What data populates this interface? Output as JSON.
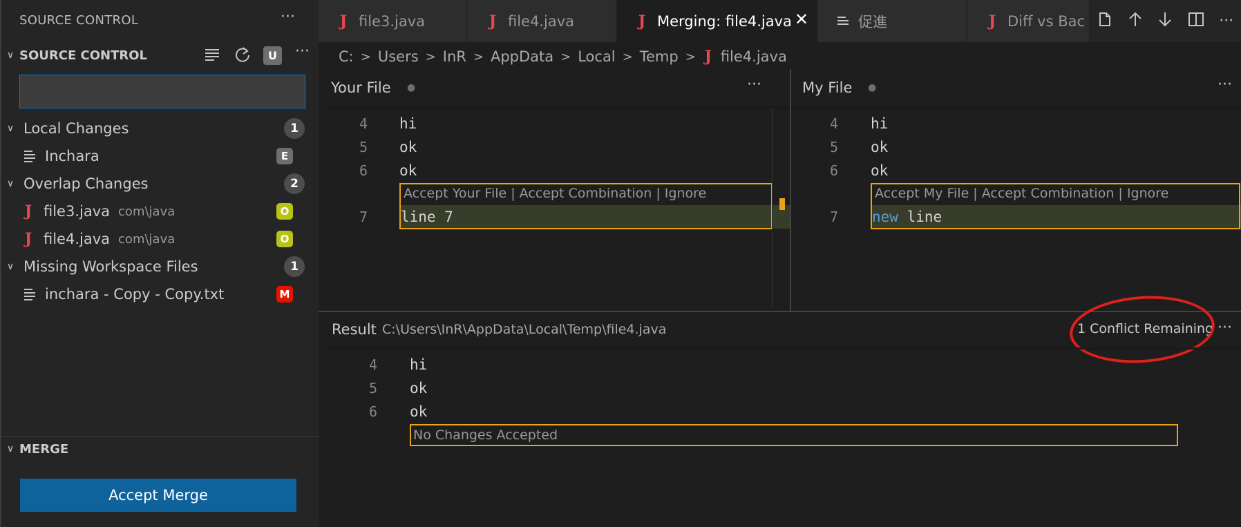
{
  "sidebar": {
    "title": "SOURCE CONTROL",
    "section_title": "SOURCE CONTROL",
    "user_badge": "U",
    "groups": [
      {
        "label": "Local Changes",
        "count": "1"
      },
      {
        "label": "Overlap Changes",
        "count": "2"
      },
      {
        "label": "Missing Workspace Files",
        "count": "1"
      }
    ],
    "items": [
      {
        "label": "Inchara",
        "desc": "",
        "status": "E"
      },
      {
        "label": "file3.java",
        "desc": "com\\java",
        "status": "O"
      },
      {
        "label": "file4.java",
        "desc": "com\\java",
        "status": "O"
      },
      {
        "label": "inchara - Copy - Copy.txt",
        "desc": "",
        "status": "M"
      }
    ],
    "merge_section": "MERGE",
    "accept_merge": "Accept Merge"
  },
  "tabs": [
    {
      "label": "file3.java",
      "icon": "java-icon"
    },
    {
      "label": "file4.java",
      "icon": "java-icon"
    },
    {
      "label": "Merging: file4.java",
      "icon": "java-icon",
      "active": true
    },
    {
      "label": "促進",
      "icon": "lines-icon"
    },
    {
      "label": "Diff vs Bac",
      "icon": "java-icon"
    }
  ],
  "breadcrumb": [
    "C:",
    "Users",
    "InR",
    "AppData",
    "Local",
    "Temp",
    "file4.java"
  ],
  "left_pane": {
    "title": "Your File",
    "lines": [
      {
        "num": "4",
        "text": "hi"
      },
      {
        "num": "5",
        "text": "ok"
      },
      {
        "num": "6",
        "text": "ok"
      }
    ],
    "codelens": "Accept Your File | Accept Combination | Ignore",
    "conflict_line": {
      "num": "7",
      "text": "line 7"
    }
  },
  "right_pane": {
    "title": "My File",
    "lines": [
      {
        "num": "4",
        "text": "hi"
      },
      {
        "num": "5",
        "text": "ok"
      },
      {
        "num": "6",
        "text": "ok"
      }
    ],
    "codelens": "Accept My File | Accept Combination | Ignore",
    "conflict_line": {
      "num": "7",
      "keyword": "new",
      "text": " line"
    }
  },
  "result_pane": {
    "label": "Result",
    "path": "C:\\Users\\InR\\AppData\\Local\\Temp\\file4.java",
    "conflicts": "1 Conflict Remaining",
    "lines": [
      {
        "num": "4",
        "text": "hi"
      },
      {
        "num": "5",
        "text": "ok"
      },
      {
        "num": "6",
        "text": "ok"
      }
    ],
    "placeholder": "No Changes Accepted"
  },
  "colors": {
    "accent": "#0e639c",
    "conflict_border": "#e8a317",
    "annotation": "#e0201a",
    "java_icon": "#e5484d"
  }
}
